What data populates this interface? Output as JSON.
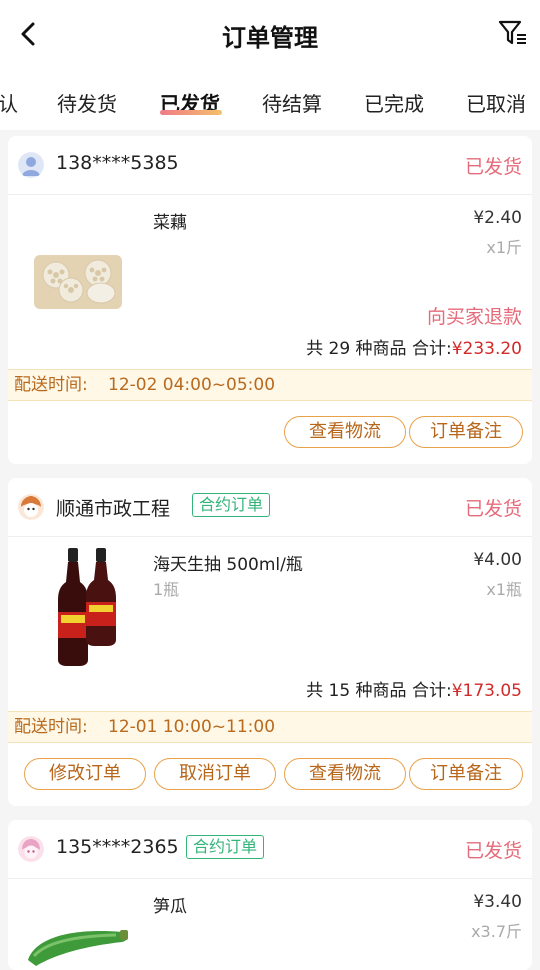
{
  "header": {
    "title": "订单管理"
  },
  "tabs": [
    {
      "label": "认"
    },
    {
      "label": "待发货"
    },
    {
      "label": "已发货"
    },
    {
      "label": "待结算"
    },
    {
      "label": "已完成"
    },
    {
      "label": "已取消"
    }
  ],
  "active_tab": "已发货",
  "orders": [
    {
      "customer": "138****5385",
      "status": "已发货",
      "product": {
        "name": "菜藕",
        "price": "¥2.40",
        "qty": "x1斤"
      },
      "refund_link": "向买家退款",
      "summary_prefix": "共 29 种商品 合计:",
      "total": "¥233.20",
      "delivery_label": "配送时间:",
      "delivery_time": "12-02 04:00~05:00",
      "buttons": [
        "查看物流",
        "订单备注"
      ]
    },
    {
      "customer": "顺通市政工程",
      "contract_badge": "合约订单",
      "status": "已发货",
      "product": {
        "name": "海天生抽 500ml/瓶",
        "spec": "1瓶",
        "price": "¥4.00",
        "qty": "x1瓶"
      },
      "summary_prefix": "共 15 种商品 合计:",
      "total": "¥173.05",
      "delivery_label": "配送时间:",
      "delivery_time": "12-01 10:00~11:00",
      "buttons": [
        "修改订单",
        "取消订单",
        "查看物流",
        "订单备注"
      ]
    },
    {
      "customer": "135****2365",
      "contract_badge": "合约订单",
      "status": "已发货",
      "product": {
        "name": "笋瓜",
        "price": "¥3.40",
        "qty": "x3.7斤"
      }
    }
  ],
  "colors": {
    "status_pink": "#e66b7a",
    "total_red": "#d12a2a",
    "button_orange": "#e9a14a",
    "contract_green": "#33b57a",
    "delivery_bg": "#fff8e6"
  },
  "icons": [
    "back-arrow-icon",
    "filter-icon",
    "avatar-icon",
    "lotus-root-image",
    "soy-sauce-image",
    "zucchini-image"
  ]
}
